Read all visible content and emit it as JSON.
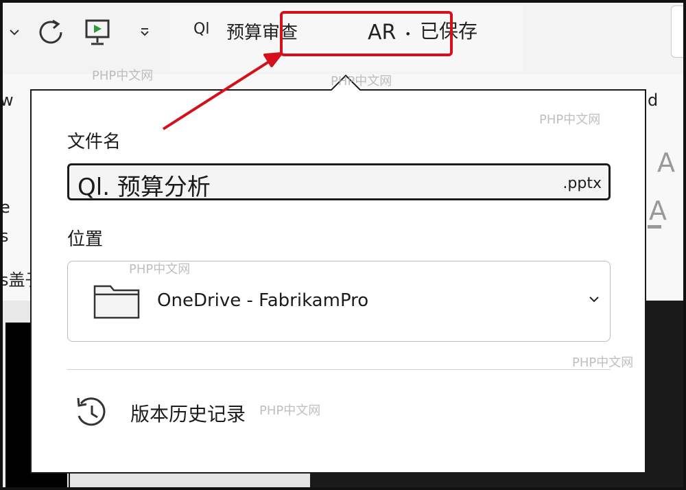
{
  "titlebar": {
    "doc_icon": "Ql",
    "doc_title": "预算审查",
    "saved_initials": "AR",
    "saved_dot": "•",
    "saved_status": "已保存",
    "icons": [
      "chevron-down-icon",
      "redo-icon",
      "present-icon",
      "customize-dropdown-icon"
    ]
  },
  "ribbon": {
    "left_fragments": [
      "w",
      "e",
      "s",
      "s盖子"
    ],
    "right_fragment": "d"
  },
  "popup": {
    "filename_label": "文件名",
    "filename_value": "Ql. 预算分析",
    "filename_ext": ".pptx",
    "location_label": "位置",
    "location_value": "OneDrive - FabrikamPro",
    "history_label": "版本历史记录"
  },
  "watermark": "PHP中文网",
  "colors": {
    "highlight_red": "#d4101a",
    "popup_border": "#1a1a1a"
  }
}
